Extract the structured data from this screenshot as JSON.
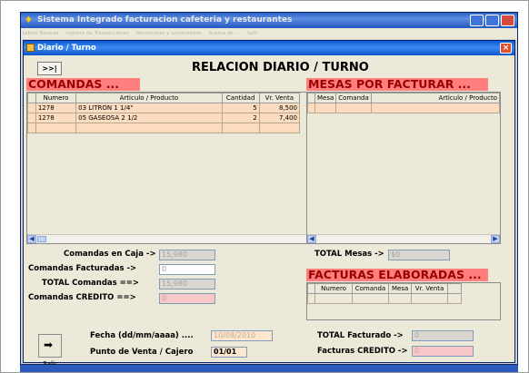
{
  "app": {
    "title": "Sistema Integrado facturacion cafeteria y restaurantes",
    "menu": [
      "tablas Basicas",
      "registro de Transacciones",
      "Resumenes y acumulados",
      "Acerca de ...",
      "Salir"
    ]
  },
  "window": {
    "title": "Diario / Turno",
    "close_label": "×"
  },
  "nav_button_label": ">>|",
  "main_title": "RELACION DIARIO / TURNO",
  "comandas": {
    "label": "COMANDAS ...",
    "columns": [
      "Numero",
      "Articulo / Producto",
      "Cantidad",
      "Vr. Venta"
    ],
    "rows": [
      {
        "numero": "1278",
        "articulo": "03 LITRON 1 1/4\"",
        "cantidad": "5",
        "venta": "8,500"
      },
      {
        "numero": "1278",
        "articulo": "05 GASEOSA 2 1/2",
        "cantidad": "2",
        "venta": "7,400"
      }
    ]
  },
  "mesas": {
    "label": "MESAS POR FACTURAR ...",
    "columns": [
      "Mesa",
      "Comanda",
      "Articulo / Producto"
    ]
  },
  "totals_left": {
    "en_caja_label": "Comandas en Caja ->",
    "en_caja_value": "15,980",
    "facturadas_label": "Comandas Facturadas ->",
    "facturadas_value": "0",
    "total_label": "TOTAL Comandas ==>",
    "total_value": "15,980",
    "credito_label": "Comandas CREDITO ==>",
    "credito_value": "0"
  },
  "total_mesas": {
    "label": "TOTAL Mesas ->",
    "value": "$0"
  },
  "facturas": {
    "label": "FACTURAS ELABORADAS ...",
    "columns": [
      "Numero",
      "Comanda",
      "Mesa",
      "Vr. Venta"
    ]
  },
  "bottom": {
    "fecha_label": "Fecha (dd/mm/aaaa) ....",
    "fecha_value": "10/08/2010",
    "punto_label": "Punto de Venta / Cajero",
    "punto_value": "01/01",
    "total_facturado_label": "TOTAL Facturado ->",
    "total_facturado_value": "0",
    "facturas_credito_label": "Facturas CREDITO ->",
    "facturas_credito_value": "0",
    "salir_label": "Salir"
  },
  "colors": {
    "section_label_bg": "#ff7f7f",
    "section_label_text": "#990000",
    "row_bg": "#fbdcc0",
    "titlebar": "#0a5ad8"
  },
  "icons": [
    "app-icon",
    "form-icon",
    "close-icon",
    "exit-arrow-icon"
  ]
}
